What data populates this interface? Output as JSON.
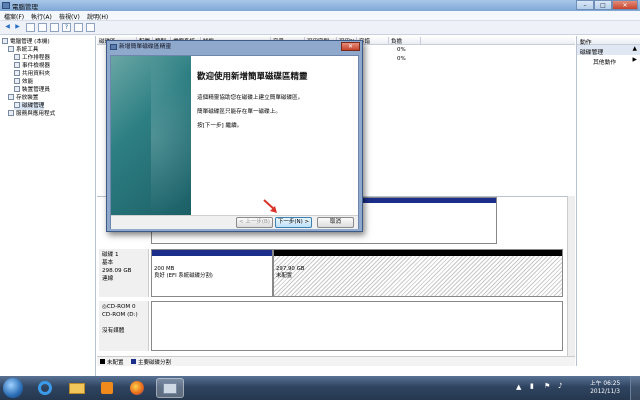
{
  "window": {
    "title": "電腦管理",
    "minimize": "–",
    "maximize": "□",
    "close": "✕"
  },
  "menu": [
    "檔案(F)",
    "執行(A)",
    "檢視(V)",
    "說明(H)"
  ],
  "tree": [
    {
      "label": "電腦管理 (本機)",
      "level": 0,
      "icon": "computer-icon"
    },
    {
      "label": "系統工具",
      "level": 1,
      "icon": "tools-icon"
    },
    {
      "label": "工作排程器",
      "level": 2,
      "icon": "clock-icon"
    },
    {
      "label": "事件檢視器",
      "level": 2,
      "icon": "event-icon"
    },
    {
      "label": "共用資料夾",
      "level": 2,
      "icon": "folder-icon"
    },
    {
      "label": "效能",
      "level": 2,
      "icon": "performance-icon"
    },
    {
      "label": "裝置管理員",
      "level": 2,
      "icon": "device-icon"
    },
    {
      "label": "存放裝置",
      "level": 1,
      "icon": "storage-icon"
    },
    {
      "label": "磁碟管理",
      "level": 2,
      "icon": "disk-icon",
      "selected": true
    },
    {
      "label": "服務與應用程式",
      "level": 1,
      "icon": "services-icon"
    }
  ],
  "volume_table": {
    "headers": [
      "磁碟區",
      "配置",
      "類型",
      "檔案系統",
      "狀態",
      "容量",
      "可用空間",
      "可用%",
      "容錯",
      "負擔"
    ],
    "rows": [
      {
        "overhead": "0%"
      },
      {
        "overhead": "0%"
      }
    ]
  },
  "disks": [
    {
      "name": "磁碟 1",
      "type": "基本",
      "size": "298.09 GB",
      "status": "連線",
      "partitions": [
        {
          "size": "200 MB",
          "desc": "良好 (EFI 系統磁碟分割)"
        },
        {
          "size": "297.90 GB",
          "desc": "未配置"
        }
      ]
    },
    {
      "name": "CD-ROM 0",
      "type": "CD-ROM (D:)",
      "status": "沒有媒體"
    }
  ],
  "legend": [
    "未配置",
    "主要磁碟分割"
  ],
  "actions": {
    "header": "動作",
    "section": "磁碟管理",
    "more": "其他動作"
  },
  "dialog": {
    "title": "新增簡單磁碟區精靈",
    "heading": "歡迎使用新增簡單磁碟區精靈",
    "lines": [
      "這個精靈協助您在磁碟上建立簡單磁碟區。",
      "簡單磁碟區只能存在單一磁碟上。",
      "按[下一步] 繼續。"
    ],
    "buttons": {
      "back": "< 上一步(B)",
      "next": "下一步(N) >",
      "cancel": "取消"
    }
  },
  "clock": {
    "time": "上午 06:25",
    "date": "2012/11/3"
  },
  "colors": {
    "primary_partition": "#1a2e8a",
    "unallocated": "#000000"
  }
}
